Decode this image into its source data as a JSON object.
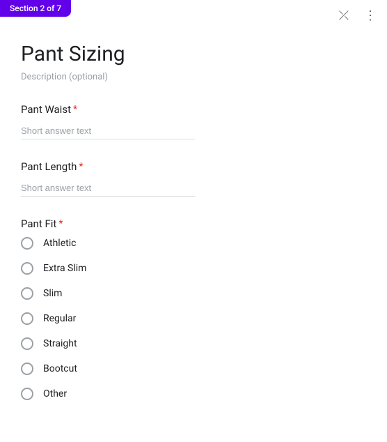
{
  "header": {
    "section_badge": "Section 2 of 7",
    "collapse_icon": "⤫",
    "more_icon": "⋮"
  },
  "form": {
    "title": "Pant Sizing",
    "description": "Description (optional)"
  },
  "questions": [
    {
      "id": "pant-waist",
      "label": "Pant Waist",
      "required": true,
      "type": "short_answer",
      "placeholder": "Short answer text"
    },
    {
      "id": "pant-length",
      "label": "Pant Length",
      "required": true,
      "type": "short_answer",
      "placeholder": "Short answer text"
    },
    {
      "id": "pant-fit",
      "label": "Pant Fit",
      "required": true,
      "type": "radio",
      "options": [
        "Athletic",
        "Extra Slim",
        "Slim",
        "Regular",
        "Straight",
        "Bootcut",
        "Other"
      ]
    }
  ],
  "icons": {
    "collapse": "⤫",
    "more": "⋮",
    "required_star": "*"
  }
}
